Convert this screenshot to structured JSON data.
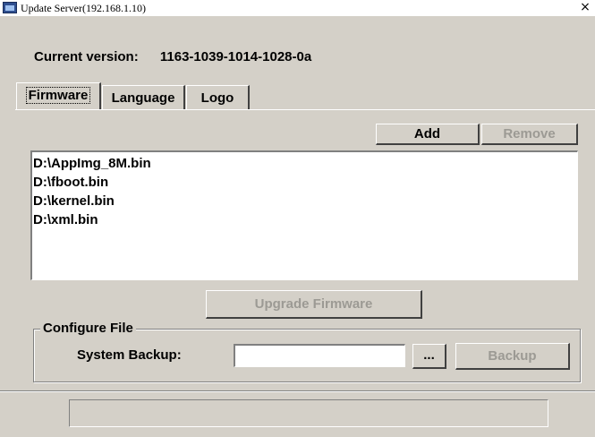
{
  "window": {
    "title": "Update Server(192.168.1.10)",
    "close_symbol": "×"
  },
  "version": {
    "label": "Current version:",
    "value": "1163-1039-1014-1028-0a"
  },
  "tabs": [
    {
      "label": "Firmware",
      "active": true
    },
    {
      "label": "Language",
      "active": false
    },
    {
      "label": "Logo",
      "active": false
    }
  ],
  "firmware": {
    "add_label": "Add",
    "remove_label": "Remove",
    "files": [
      "D:\\AppImg_8M.bin",
      "D:\\fboot.bin",
      "D:\\kernel.bin",
      "D:\\xml.bin"
    ],
    "upgrade_label": "Upgrade Firmware"
  },
  "configure": {
    "group_label": "Configure File",
    "backup_label": "System Backup:",
    "backup_value": "",
    "browse_label": "...",
    "backup_button_label": "Backup"
  },
  "status": {
    "text": ""
  }
}
